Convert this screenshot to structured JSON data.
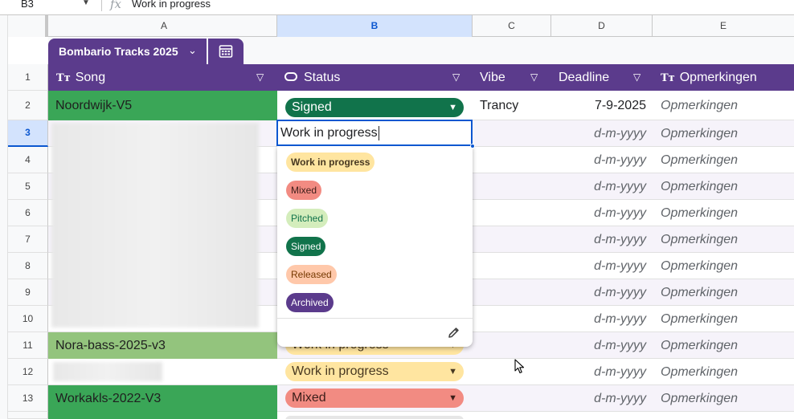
{
  "formula_bar": {
    "cell_ref": "B3",
    "fx": "fx",
    "value": "Work in progress"
  },
  "columns": [
    "A",
    "B",
    "C",
    "D",
    "E"
  ],
  "rows": [
    "1",
    "2",
    "3",
    "4",
    "5",
    "6",
    "7",
    "8",
    "9",
    "10",
    "11",
    "12",
    "13"
  ],
  "table": {
    "name": "Bombario Tracks 2025",
    "headers": {
      "song": "Song",
      "status": "Status",
      "vibe": "Vibe",
      "deadline": "Deadline",
      "notes": "Opmerkingen"
    },
    "data": [
      {
        "song": "Noordwijk-V5",
        "status": "Signed",
        "vibe": "Trancy",
        "deadline": "7-9-2025",
        "notes": "Opmerkingen"
      },
      {
        "song": "",
        "status": "Work in progress",
        "vibe": "",
        "deadline": "d-m-yyyy",
        "notes": "Opmerkingen"
      },
      {
        "deadline": "d-m-yyyy",
        "notes": "Opmerkingen"
      },
      {
        "deadline": "d-m-yyyy",
        "notes": "Opmerkingen"
      },
      {
        "deadline": "d-m-yyyy",
        "notes": "Opmerkingen"
      },
      {
        "deadline": "d-m-yyyy",
        "notes": "Opmerkingen"
      },
      {
        "deadline": "d-m-yyyy",
        "notes": "Opmerkingen"
      },
      {
        "deadline": "d-m-yyyy",
        "notes": "Opmerkingen"
      },
      {
        "deadline": "d-m-yyyy",
        "notes": "Opmerkingen"
      },
      {
        "song": "Nora-bass-2025-v3",
        "status": "Work in progress",
        "deadline": "d-m-yyyy",
        "notes": "Opmerkingen"
      },
      {
        "song": "",
        "status": "Work in progress",
        "deadline": "d-m-yyyy",
        "notes": "Opmerkingen"
      },
      {
        "song": "Workakls-2022-V3",
        "status": "Mixed",
        "deadline": "d-m-yyyy",
        "notes": "Opmerkingen"
      }
    ]
  },
  "editor": {
    "value": "Work in progress"
  },
  "dropdown": {
    "options": [
      "Work in progress",
      "Mixed",
      "Pitched",
      "Signed",
      "Released",
      "Archived"
    ]
  },
  "colors": {
    "header_purple": "#5b3b8c",
    "song_green": "#3aa657",
    "song_lightgreen": "#93c47d",
    "signed": "#11734b",
    "wip": "#ffe5a0",
    "mixed": "#f28b82",
    "pitched": "#d4edbc",
    "released": "#ffc8aa",
    "archived": "#5b3b8c",
    "selection_blue": "#0b57d0"
  }
}
